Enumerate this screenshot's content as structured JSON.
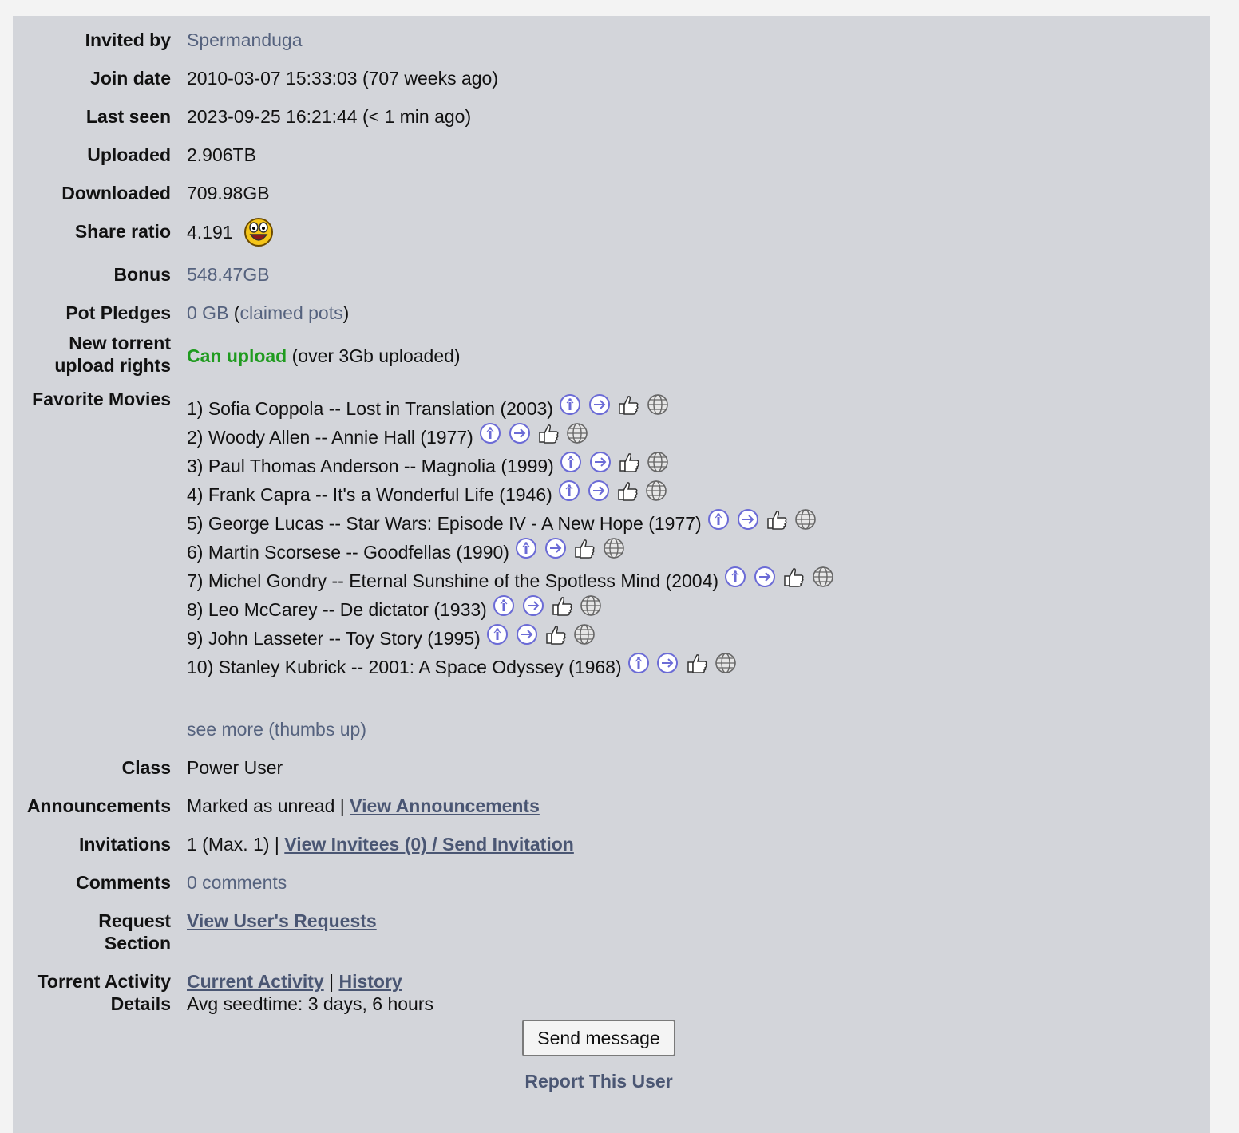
{
  "rows": {
    "invited_by": {
      "label": "Invited by",
      "value": "Spermanduga"
    },
    "join_date": {
      "label": "Join date",
      "value": "2010-03-07 15:33:03 (707 weeks ago)"
    },
    "last_seen": {
      "label": "Last seen",
      "value": "2023-09-25 16:21:44 (< 1 min ago)"
    },
    "uploaded": {
      "label": "Uploaded",
      "value": "2.906TB"
    },
    "downloaded": {
      "label": "Downloaded",
      "value": "709.98GB"
    },
    "share_ratio": {
      "label": "Share ratio",
      "value": "4.191",
      "icon": "happy-smiley-icon"
    },
    "bonus": {
      "label": "Bonus",
      "value": "548.47GB"
    },
    "pot_pledges": {
      "label": "Pot Pledges",
      "gb": "0 GB",
      "open": " (",
      "link": "claimed pots",
      "close": ")"
    },
    "upload_rights": {
      "label1": "New torrent",
      "label2": "upload rights",
      "status": "Can upload",
      "detail": " (over 3Gb uploaded)"
    },
    "favorite_movies": {
      "label": "Favorite Movies",
      "items": [
        "1) Sofia Coppola -- Lost in Translation (2003)",
        "2) Woody Allen -- Annie Hall (1977)",
        "3) Paul Thomas Anderson -- Magnolia (1999)",
        "4) Frank Capra -- It's a Wonderful Life (1946)",
        "5) George Lucas -- Star Wars: Episode IV - A New Hope (1977)",
        "6) Martin Scorsese -- Goodfellas (1990)",
        "7) Michel Gondry -- Eternal Sunshine of the Spotless Mind (2004)",
        "8) Leo McCarey -- De dictator (1933)",
        "9) John Lasseter -- Toy Story (1995)",
        "10) Stanley Kubrick -- 2001: A Space Odyssey (1968)"
      ],
      "icons": [
        "info-icon",
        "go-arrow-icon",
        "thumbs-up-icon",
        "globe-icon"
      ],
      "see_more": "see more (thumbs up)"
    },
    "class": {
      "label": "Class",
      "value": "Power User"
    },
    "announcements": {
      "label": "Announcements",
      "text": "Marked as unread | ",
      "link": "View Announcements"
    },
    "invitations": {
      "label": "Invitations",
      "text": "1 (Max. 1) | ",
      "link": "View Invitees (0) / Send Invitation"
    },
    "comments": {
      "label": "Comments",
      "link": "0 comments"
    },
    "request": {
      "label1": "Request",
      "label2": "Section",
      "link": "View User's Requests"
    },
    "activity": {
      "label1": "Torrent Activity",
      "label2": "Details",
      "link1": "Current Activity",
      "sep": " | ",
      "link2": "History",
      "seedtime": "Avg seedtime: 3 days, 6 hours"
    }
  },
  "actions": {
    "send_message": "Send message",
    "report": "Report This User"
  },
  "colors": {
    "panel": "#d3d5da",
    "link": "#55627e",
    "green": "#1f9b1f",
    "icon": "#6b6bd6"
  }
}
